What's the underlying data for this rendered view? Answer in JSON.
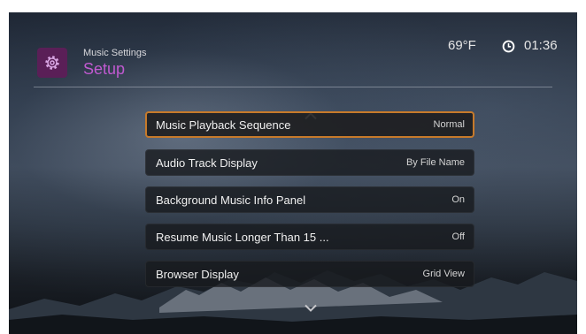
{
  "header": {
    "subtitle": "Music Settings",
    "title": "Setup",
    "icon": "gear-icon",
    "accent_color": "#c05ad0"
  },
  "status": {
    "temperature": "69°F",
    "time": "01:36",
    "clock_icon": "clock-icon"
  },
  "menu": {
    "scroll_up_icon": "chevron-up-icon",
    "scroll_down_icon": "chevron-down-icon",
    "selected_index": 0,
    "selection_color": "#c77a2a",
    "items": [
      {
        "label": "Music Playback Sequence",
        "value": "Normal"
      },
      {
        "label": "Audio Track Display",
        "value": "By File Name"
      },
      {
        "label": "Background Music Info Panel",
        "value": "On"
      },
      {
        "label": "Resume Music Longer Than 15 ...",
        "value": "Off"
      },
      {
        "label": "Browser Display",
        "value": "Grid View"
      }
    ]
  }
}
